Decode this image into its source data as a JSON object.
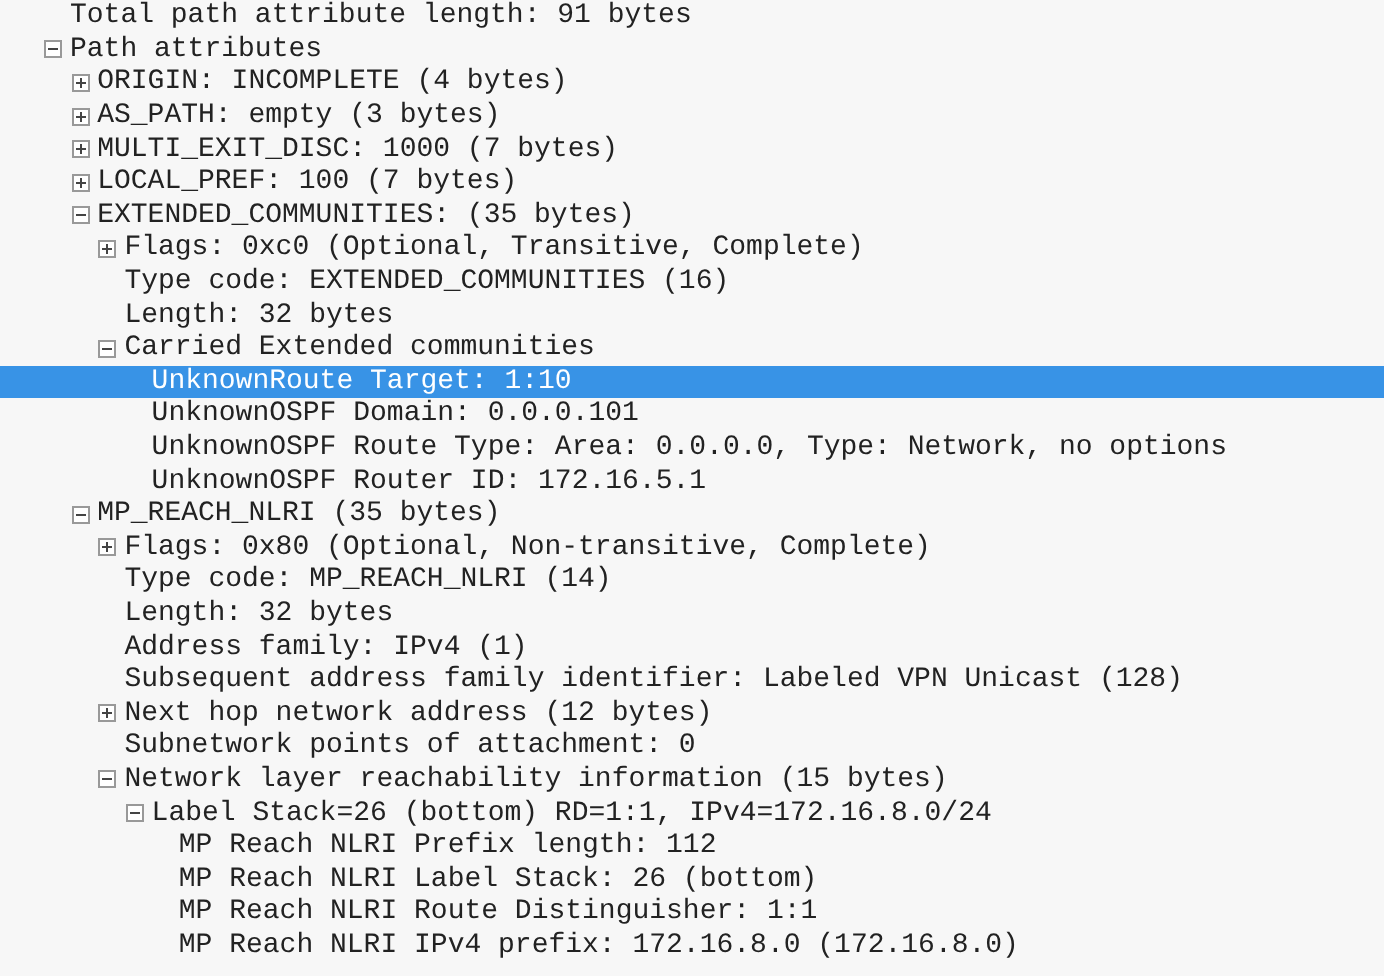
{
  "tree": [
    {
      "text": "Total path attribute length: 91 bytes",
      "selected": false
    },
    {
      "text": "Path attributes",
      "selected": false,
      "expanded": true,
      "children": [
        {
          "text": "ORIGIN: INCOMPLETE (4 bytes)",
          "selected": false,
          "expanded": false
        },
        {
          "text": "AS_PATH: empty (3 bytes)",
          "selected": false,
          "expanded": false
        },
        {
          "text": "MULTI_EXIT_DISC: 1000 (7 bytes)",
          "selected": false,
          "expanded": false
        },
        {
          "text": "LOCAL_PREF: 100 (7 bytes)",
          "selected": false,
          "expanded": false
        },
        {
          "text": "EXTENDED_COMMUNITIES: (35 bytes)",
          "selected": false,
          "expanded": true,
          "children": [
            {
              "text": "Flags: 0xc0 (Optional, Transitive, Complete)",
              "selected": false,
              "expanded": false
            },
            {
              "text": "Type code: EXTENDED_COMMUNITIES (16)",
              "selected": false
            },
            {
              "text": "Length: 32 bytes",
              "selected": false
            },
            {
              "text": "Carried Extended communities",
              "selected": false,
              "expanded": true,
              "children": [
                {
                  "text": "UnknownRoute Target: 1:10",
                  "selected": true
                },
                {
                  "text": "UnknownOSPF Domain: 0.0.0.101",
                  "selected": false
                },
                {
                  "text": "UnknownOSPF Route Type: Area: 0.0.0.0, Type: Network, no options",
                  "selected": false
                },
                {
                  "text": "UnknownOSPF Router ID: 172.16.5.1",
                  "selected": false
                }
              ]
            }
          ]
        },
        {
          "text": "MP_REACH_NLRI (35 bytes)",
          "selected": false,
          "expanded": true,
          "children": [
            {
              "text": "Flags: 0x80 (Optional, Non-transitive, Complete)",
              "selected": false,
              "expanded": false
            },
            {
              "text": "Type code: MP_REACH_NLRI (14)",
              "selected": false
            },
            {
              "text": "Length: 32 bytes",
              "selected": false
            },
            {
              "text": "Address family: IPv4 (1)",
              "selected": false
            },
            {
              "text": "Subsequent address family identifier: Labeled VPN Unicast (128)",
              "selected": false
            },
            {
              "text": "Next hop network address (12 bytes)",
              "selected": false,
              "expanded": false
            },
            {
              "text": "Subnetwork points of attachment: 0",
              "selected": false
            },
            {
              "text": "Network layer reachability information (15 bytes)",
              "selected": false,
              "expanded": true,
              "children": [
                {
                  "text": "Label Stack=26 (bottom) RD=1:1, IPv4=172.16.8.0/24",
                  "selected": false,
                  "expanded": true,
                  "children": [
                    {
                      "text": "MP Reach NLRI Prefix length: 112",
                      "selected": false
                    },
                    {
                      "text": "MP Reach NLRI Label Stack: 26 (bottom)",
                      "selected": false
                    },
                    {
                      "text": "MP Reach NLRI Route Distinguisher: 1:1",
                      "selected": false
                    },
                    {
                      "text": "MP Reach NLRI IPv4 prefix: 172.16.8.0 (172.16.8.0)",
                      "selected": false
                    }
                  ]
                }
              ]
            }
          ]
        }
      ]
    }
  ]
}
